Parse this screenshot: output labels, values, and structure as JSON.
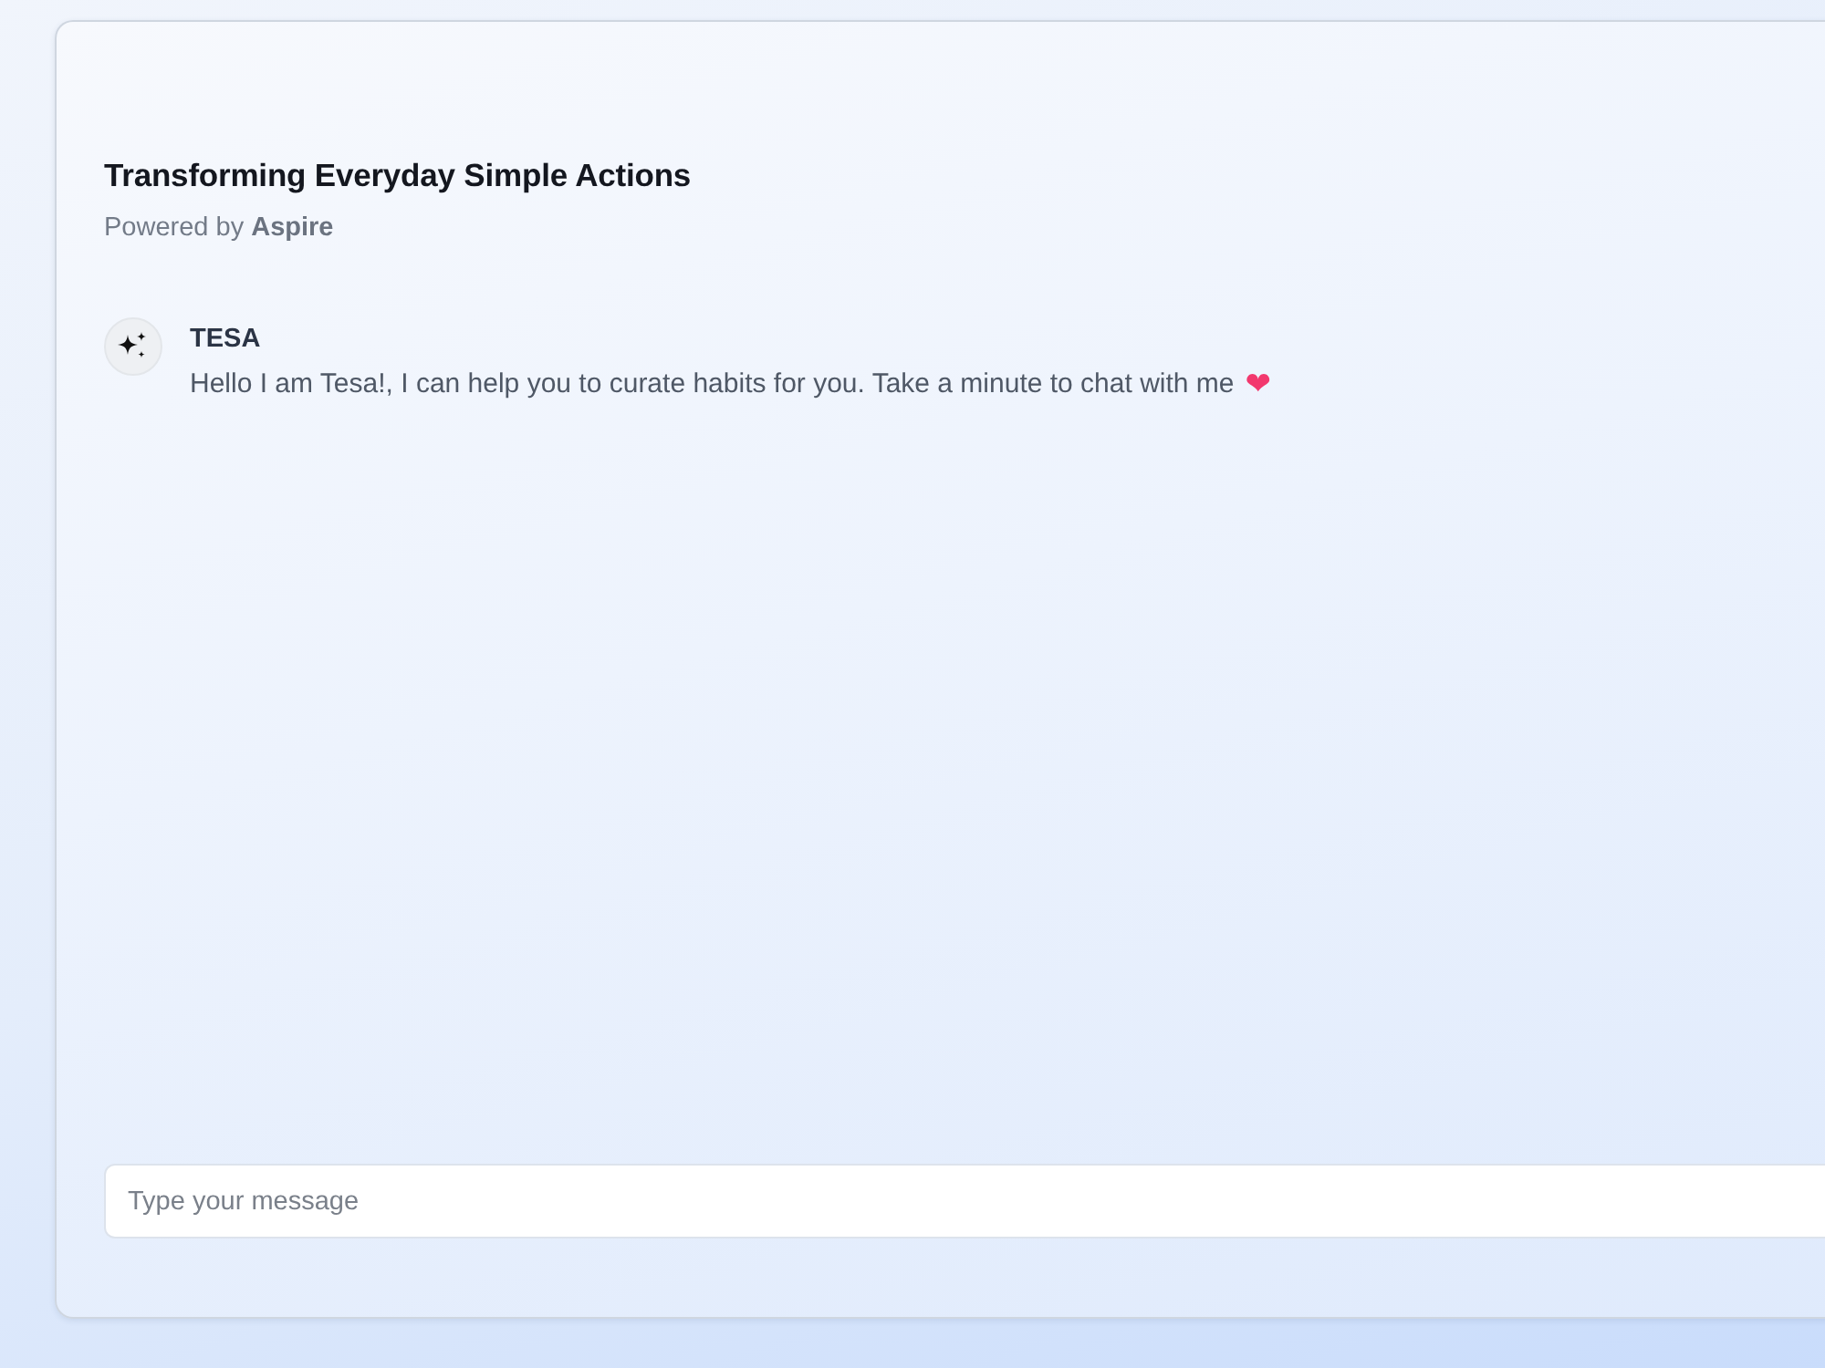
{
  "header": {
    "title": "Transforming Everyday Simple Actions",
    "subtitle": "Powered by **Aspire**"
  },
  "messages": [
    {
      "sender": "TESA",
      "text": "Hello I am Tesa!, I can help you to curate habits for you. Take a minute to chat with me",
      "emoji": "❤"
    }
  ],
  "composer": {
    "placeholder": "Type your message"
  }
}
